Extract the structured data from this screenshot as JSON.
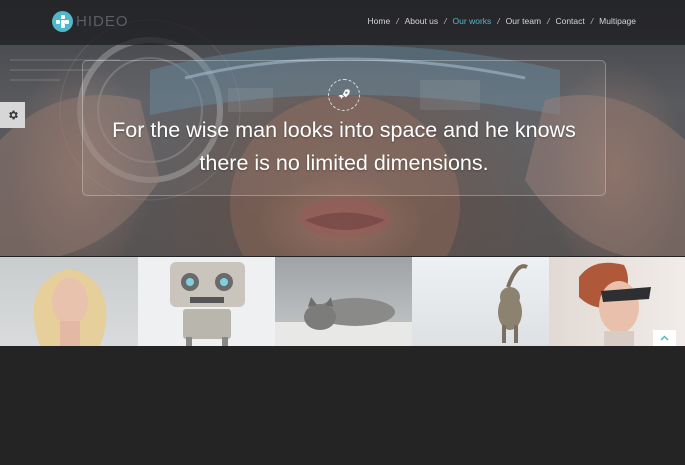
{
  "header": {
    "logo_text": "HIDEO",
    "nav": [
      {
        "label": "Home",
        "active": false
      },
      {
        "label": "About us",
        "active": false
      },
      {
        "label": "Our works",
        "active": true
      },
      {
        "label": "Our team",
        "active": false
      },
      {
        "label": "Contact",
        "active": false
      },
      {
        "label": "Multipage",
        "active": false
      }
    ],
    "nav_separator": "/"
  },
  "hero": {
    "quote_line1": "For the wise man looks into space and he knows",
    "quote_line2": "there is no limited dimensions.",
    "icon": "rocket-icon"
  },
  "sidebar": {
    "settings_icon": "gear-icon"
  },
  "gallery": {
    "items": [
      "woman-blonde",
      "robot",
      "kitten-lying",
      "kitten-walking",
      "woman-vr-glasses"
    ]
  },
  "scroll_top_icon": "chevron-up-icon",
  "colors": {
    "accent": "#4fb8c9",
    "background": "#242424",
    "header": "#1c1c1e"
  }
}
